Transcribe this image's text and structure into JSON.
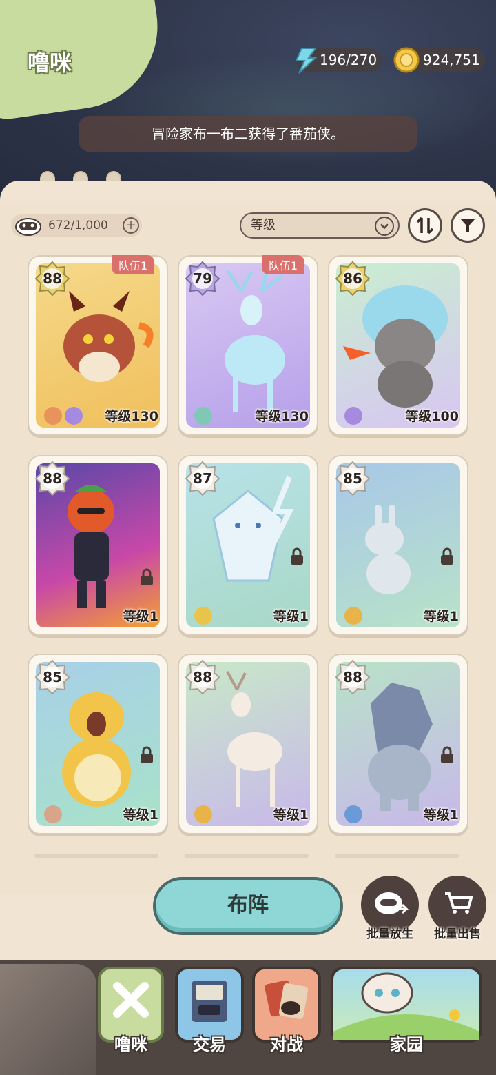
{
  "header": {
    "title": "噜咪"
  },
  "resources": {
    "energy": "196/270",
    "coins": "924,751"
  },
  "toast": "冒险家布一布二获得了番茄侠。",
  "collection": {
    "count": "672/1,000"
  },
  "sort": {
    "selected": "等级"
  },
  "cards": [
    {
      "rarity": "88",
      "level": "等级130",
      "team": "队伍1"
    },
    {
      "rarity": "79",
      "level": "等级130",
      "team": "队伍1"
    },
    {
      "rarity": "86",
      "level": "等级100"
    },
    {
      "rarity": "88",
      "level": "等级1"
    },
    {
      "rarity": "87",
      "level": "等级1"
    },
    {
      "rarity": "85",
      "level": "等级1"
    },
    {
      "rarity": "85",
      "level": "等级1"
    },
    {
      "rarity": "88",
      "level": "等级1"
    },
    {
      "rarity": "88",
      "level": "等级1"
    }
  ],
  "actions": {
    "deploy": "布阵",
    "batch_release": "批量放生",
    "batch_sell": "批量出售"
  },
  "nav": {
    "tabs": [
      "噜咪",
      "交易",
      "对战",
      "家园"
    ]
  }
}
